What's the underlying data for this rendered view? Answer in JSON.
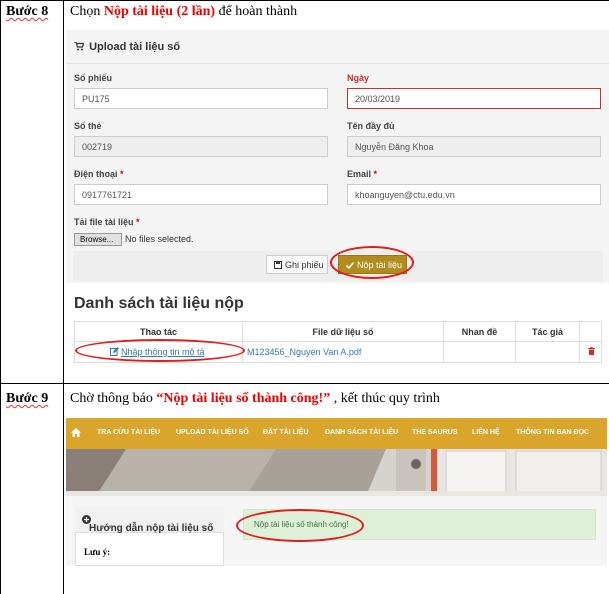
{
  "step8": {
    "label": "Bước 8",
    "desc_pre": "Chọn ",
    "desc_hl": "Nộp tài liệu (2 lần)",
    "desc_post": " để hoàn thành"
  },
  "form": {
    "panel_title": "Upload tài liệu số",
    "so_phieu_label": "Số phiếu",
    "so_phieu_value": "PU175",
    "ngay_label": "Ngày",
    "ngay_value": "20/03/2019",
    "so_the_label": "Số thẻ",
    "so_the_value": "002719",
    "ten_label": "Tên đầy đủ",
    "ten_value": "Nguyễn Đăng Khoa",
    "dien_thoai_label": "Điện thoại",
    "dien_thoai_value": "0917761721",
    "email_label": "Email",
    "email_value": "khoanguyen@ctu.edu.vn",
    "file_label": "Tải file tài liệu",
    "required_mark": "*",
    "browse_label": "Browse...",
    "no_file_text": "No files selected.",
    "ghi_phieu_label": "Ghi phiếu",
    "nop_label": "Nộp tài liệu"
  },
  "list": {
    "title": "Danh sách tài liệu nộp",
    "headers": [
      "Thao tác",
      "File dữ liệu số",
      "Nhan đề",
      "Tác giả"
    ],
    "row": {
      "action": "Nhập thông tin mô tả",
      "file": "M123456_Nguyen Van A.pdf"
    }
  },
  "step9": {
    "label": "Bước 9",
    "desc_pre": "Chờ thông báo  ",
    "desc_hl": "“Nộp tài liệu số thành công!”",
    "desc_post": " , kết thúc quy trình"
  },
  "nav": {
    "items": [
      "TRA CỨU TÀI LIỆU",
      "UPLOAD TÀI LIỆU SỐ",
      "ĐẶT TÀI LIỆU",
      "DANH SÁCH TÀI LIỆU",
      "THE SAURUS",
      "LIÊN HỆ",
      "THÔNG TIN BẠN ĐỌC"
    ]
  },
  "sidebar": {
    "title": "Hướng dẫn nộp tài liệu số",
    "note": "Lưu ý:"
  },
  "alert": {
    "message": "Nộp tài liệu số thành công!"
  },
  "colors": {
    "accent": "#d9a52b",
    "highlight": "#e00000",
    "success_bg": "#dff0d8"
  }
}
